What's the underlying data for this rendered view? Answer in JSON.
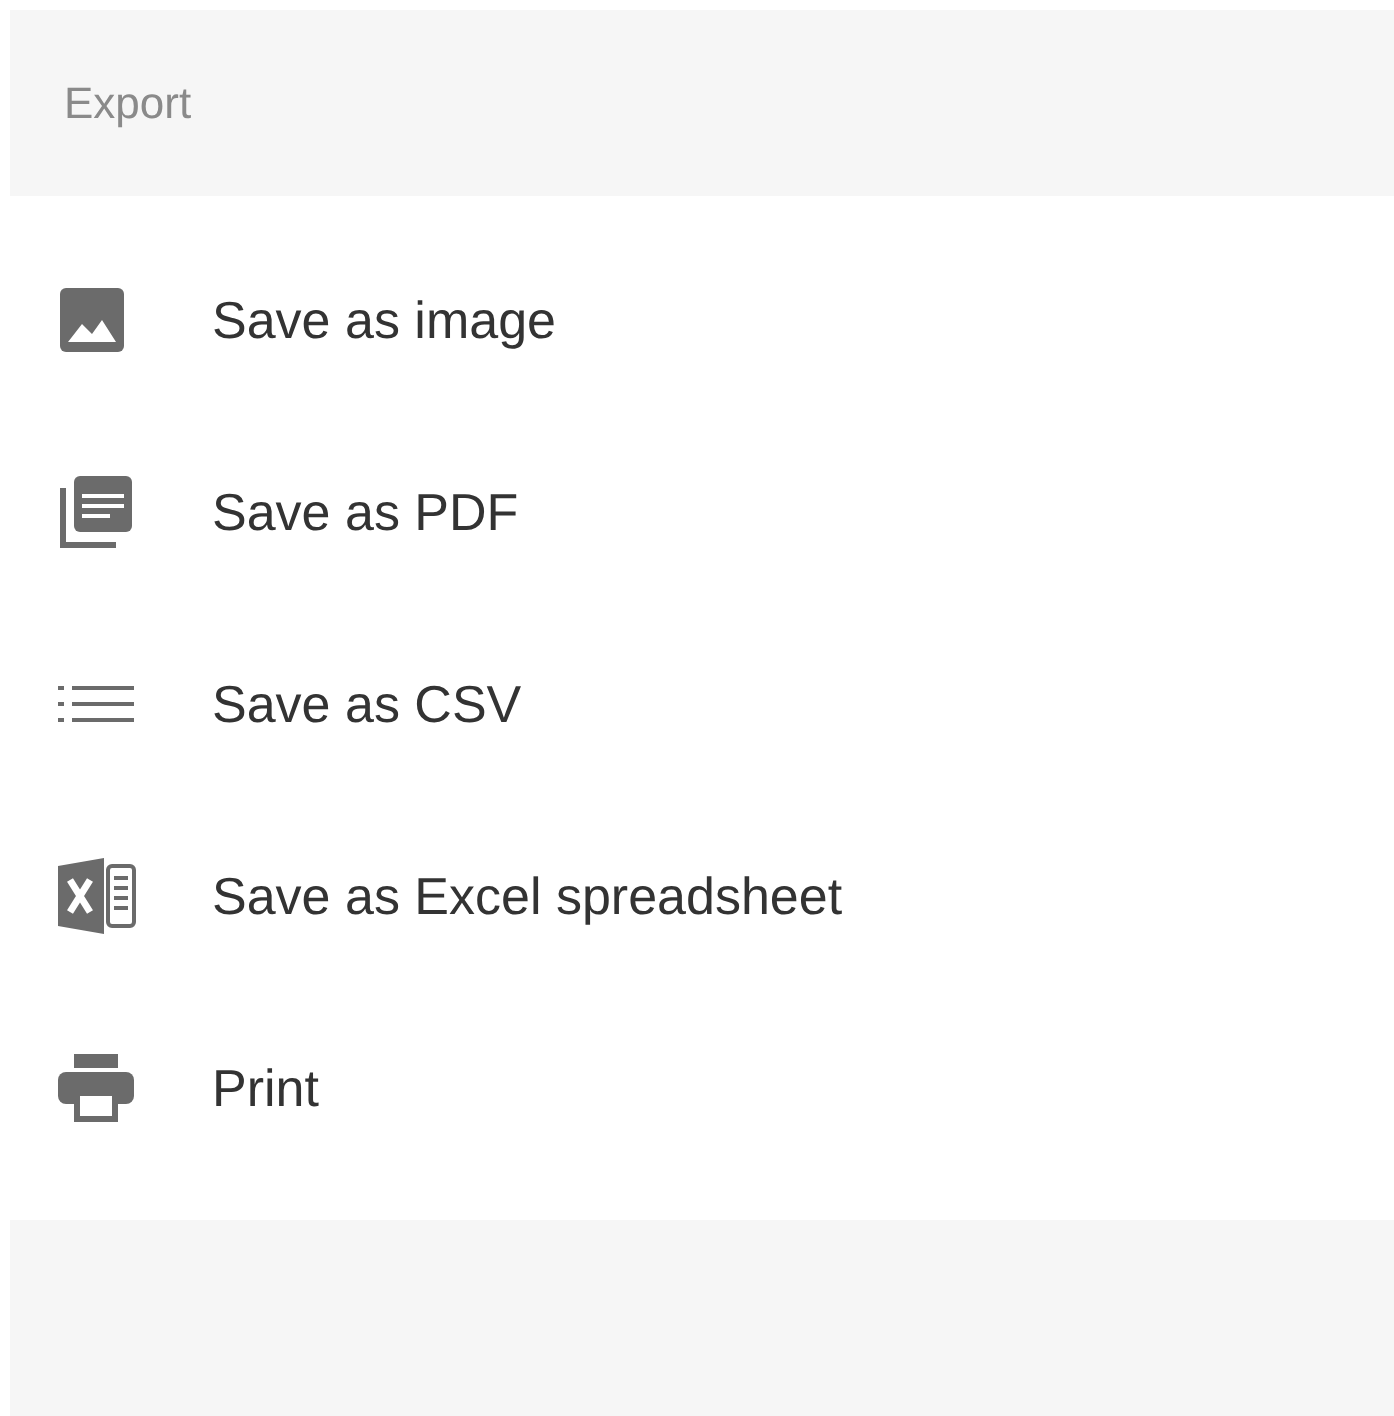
{
  "header": {
    "title": "Export"
  },
  "items": [
    {
      "kind": "image",
      "label": "Save as image"
    },
    {
      "kind": "pdf",
      "label": "Save as PDF"
    },
    {
      "kind": "csv",
      "label": "Save as CSV"
    },
    {
      "kind": "excel",
      "label": "Save as Excel spreadsheet"
    },
    {
      "kind": "print",
      "label": "Print"
    }
  ]
}
